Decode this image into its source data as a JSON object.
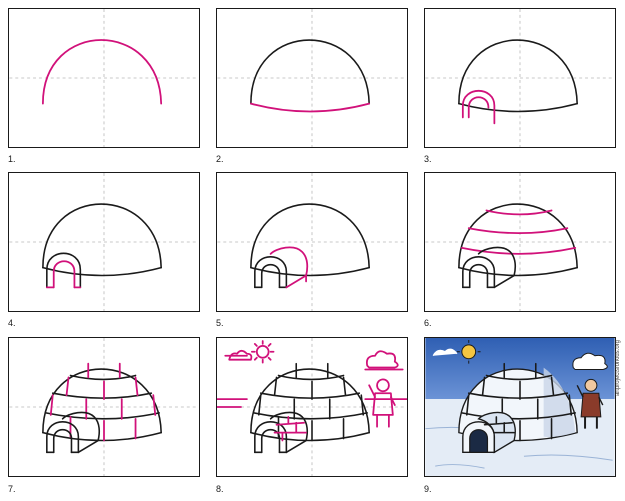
{
  "steps": [
    {
      "number": "1."
    },
    {
      "number": "2."
    },
    {
      "number": "3."
    },
    {
      "number": "4."
    },
    {
      "number": "5."
    },
    {
      "number": "6."
    },
    {
      "number": "7."
    },
    {
      "number": "8."
    },
    {
      "number": "9."
    }
  ],
  "colors": {
    "guide_line": "#b8b8b8",
    "outline": "#1a1a1a",
    "new_step": "#d1117a",
    "sky": "#3d6fbf",
    "snow": "#dfe9f5",
    "sun": "#f4c542"
  },
  "watermark": "artprojectsforkids.org",
  "icons": [
    "sun-icon",
    "cloud-icon",
    "person-figure"
  ]
}
